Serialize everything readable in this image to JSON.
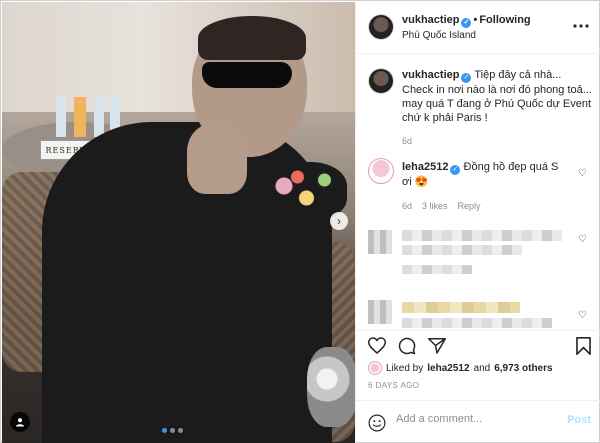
{
  "post": {
    "username": "vukhactiep",
    "follow_label": "Following",
    "location": "Phú Quốc Island",
    "caption": "Tiệp đây cả nhà... Check in nơi nào là nơi đó phong toả... may quá T đang ở Phú Quốc dự Event chứ k phải Paris !",
    "caption_age": "6d",
    "photo_sign_text": "RESERVED",
    "carousel_dots": 3,
    "active_dot": 1
  },
  "comments": [
    {
      "username": "leha2512",
      "text": "Đồng hồ đẹp quá S ơi 😍",
      "age": "6d",
      "likes": "3 likes",
      "reply_label": "Reply"
    }
  ],
  "likes": {
    "liked_by_prefix": "Liked by",
    "liked_by_user": "leha2512",
    "and_label": "and",
    "others": "6,973 others"
  },
  "age_label": "6 DAYS AGO",
  "add_comment": {
    "placeholder": "Add a comment...",
    "post_label": "Post"
  },
  "colors": {
    "accent": "#3897f0",
    "post_disabled": "#b2dffc",
    "muted": "#8e8e8e"
  }
}
